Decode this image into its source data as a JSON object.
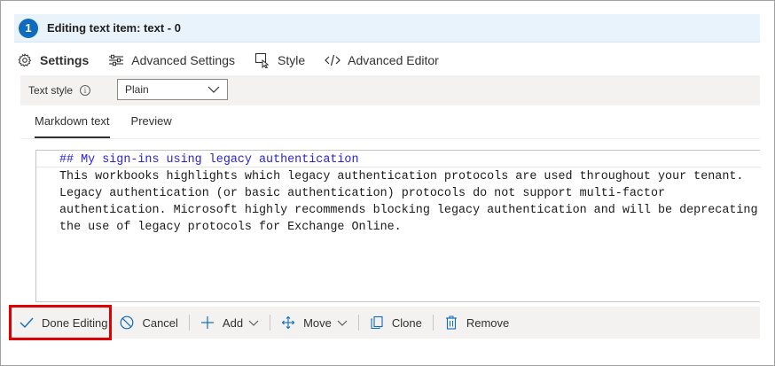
{
  "header": {
    "step_number": "1",
    "title": "Editing text item: text - 0"
  },
  "tabs": [
    {
      "label": "Settings",
      "icon": "gear-icon",
      "active": true
    },
    {
      "label": "Advanced Settings",
      "icon": "sliders-icon",
      "active": false
    },
    {
      "label": "Style",
      "icon": "style-icon",
      "active": false
    },
    {
      "label": "Advanced Editor",
      "icon": "code-icon",
      "active": false
    }
  ],
  "settings": {
    "text_style_label": "Text style",
    "text_style_value": "Plain"
  },
  "subtabs": [
    {
      "label": "Markdown text",
      "active": true
    },
    {
      "label": "Preview",
      "active": false
    }
  ],
  "editor": {
    "lines": [
      "## My sign-ins using legacy authentication",
      "This workbooks highlights which legacy authentication protocols are used throughout your tenant.",
      "Legacy authentication (or basic authentication) protocols do not support multi-factor",
      "authentication. Microsoft highly recommends blocking legacy authentication and will be deprecating",
      "the use of legacy protocols for Exchange Online."
    ]
  },
  "toolbar": {
    "done_label": "Done Editing",
    "cancel_label": "Cancel",
    "add_label": "Add",
    "move_label": "Move",
    "clone_label": "Clone",
    "remove_label": "Remove"
  },
  "colors": {
    "accent": "#0f6cbd",
    "header_bg": "#e8f3fc",
    "highlight_outline": "#e00000",
    "markdown_heading": "#2b21e0"
  }
}
